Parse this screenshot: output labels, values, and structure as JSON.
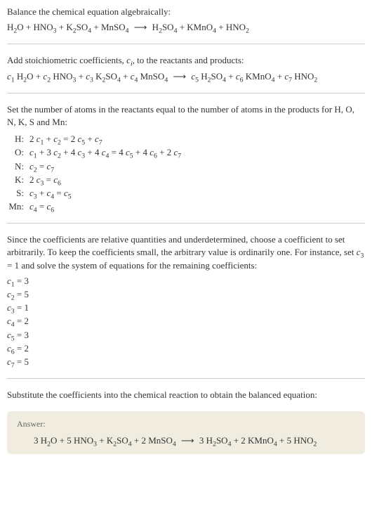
{
  "intro": {
    "line1": "Balance the chemical equation algebraically:",
    "equation_html": "H<span class='sub'>2</span>O + HNO<span class='sub'>3</span> + K<span class='sub'>2</span>SO<span class='sub'>4</span> + MnSO<span class='sub'>4</span> <span class='arrow'>⟶</span> H<span class='sub'>2</span>SO<span class='sub'>4</span> + KMnO<span class='sub'>4</span> + HNO<span class='sub'>2</span>"
  },
  "stoich": {
    "line1_html": "Add stoichiometric coefficients, <span class='italic'>c<span class='sub'>i</span></span>, to the reactants and products:",
    "equation_html": "<span class='italic'>c</span><span class='sub'>1</span> H<span class='sub'>2</span>O + <span class='italic'>c</span><span class='sub'>2</span> HNO<span class='sub'>3</span> + <span class='italic'>c</span><span class='sub'>3</span> K<span class='sub'>2</span>SO<span class='sub'>4</span> + <span class='italic'>c</span><span class='sub'>4</span> MnSO<span class='sub'>4</span> <span class='arrow'>⟶</span> <span class='italic'>c</span><span class='sub'>5</span> H<span class='sub'>2</span>SO<span class='sub'>4</span> + <span class='italic'>c</span><span class='sub'>6</span> KMnO<span class='sub'>4</span> + <span class='italic'>c</span><span class='sub'>7</span> HNO<span class='sub'>2</span>"
  },
  "atoms": {
    "line1": "Set the number of atoms in the reactants equal to the number of atoms in the products for H, O, N, K, S and Mn:",
    "rows": [
      {
        "label": "H:",
        "eq_html": "2 <span class='italic'>c</span><span class='sub'>1</span> + <span class='italic'>c</span><span class='sub'>2</span> = 2 <span class='italic'>c</span><span class='sub'>5</span> + <span class='italic'>c</span><span class='sub'>7</span>"
      },
      {
        "label": "O:",
        "eq_html": "<span class='italic'>c</span><span class='sub'>1</span> + 3 <span class='italic'>c</span><span class='sub'>2</span> + 4 <span class='italic'>c</span><span class='sub'>3</span> + 4 <span class='italic'>c</span><span class='sub'>4</span> = 4 <span class='italic'>c</span><span class='sub'>5</span> + 4 <span class='italic'>c</span><span class='sub'>6</span> + 2 <span class='italic'>c</span><span class='sub'>7</span>"
      },
      {
        "label": "N:",
        "eq_html": "<span class='italic'>c</span><span class='sub'>2</span> = <span class='italic'>c</span><span class='sub'>7</span>"
      },
      {
        "label": "K:",
        "eq_html": "2 <span class='italic'>c</span><span class='sub'>3</span> = <span class='italic'>c</span><span class='sub'>6</span>"
      },
      {
        "label": "S:",
        "eq_html": "<span class='italic'>c</span><span class='sub'>3</span> + <span class='italic'>c</span><span class='sub'>4</span> = <span class='italic'>c</span><span class='sub'>5</span>"
      },
      {
        "label": "Mn:",
        "eq_html": "<span class='italic'>c</span><span class='sub'>4</span> = <span class='italic'>c</span><span class='sub'>6</span>"
      }
    ]
  },
  "solve": {
    "text_html": "Since the coefficients are relative quantities and underdetermined, choose a coefficient to set arbitrarily. To keep the coefficients small, the arbitrary value is ordinarily one. For instance, set <span class='italic'>c</span><span class='sub'>3</span> = 1 and solve the system of equations for the remaining coefficients:",
    "coefs": [
      {
        "html": "<span class='italic'>c</span><span class='sub'>1</span> = 3"
      },
      {
        "html": "<span class='italic'>c</span><span class='sub'>2</span> = 5"
      },
      {
        "html": "<span class='italic'>c</span><span class='sub'>3</span> = 1"
      },
      {
        "html": "<span class='italic'>c</span><span class='sub'>4</span> = 2"
      },
      {
        "html": "<span class='italic'>c</span><span class='sub'>5</span> = 3"
      },
      {
        "html": "<span class='italic'>c</span><span class='sub'>6</span> = 2"
      },
      {
        "html": "<span class='italic'>c</span><span class='sub'>7</span> = 5"
      }
    ]
  },
  "substitute": {
    "text": "Substitute the coefficients into the chemical reaction to obtain the balanced equation:"
  },
  "answer": {
    "label": "Answer:",
    "equation_html": "3 H<span class='sub'>2</span>O + 5 HNO<span class='sub'>3</span> + K<span class='sub'>2</span>SO<span class='sub'>4</span> + 2 MnSO<span class='sub'>4</span> <span class='arrow'>⟶</span> 3 H<span class='sub'>2</span>SO<span class='sub'>4</span> + 2 KMnO<span class='sub'>4</span> + 5 HNO<span class='sub'>2</span>"
  }
}
